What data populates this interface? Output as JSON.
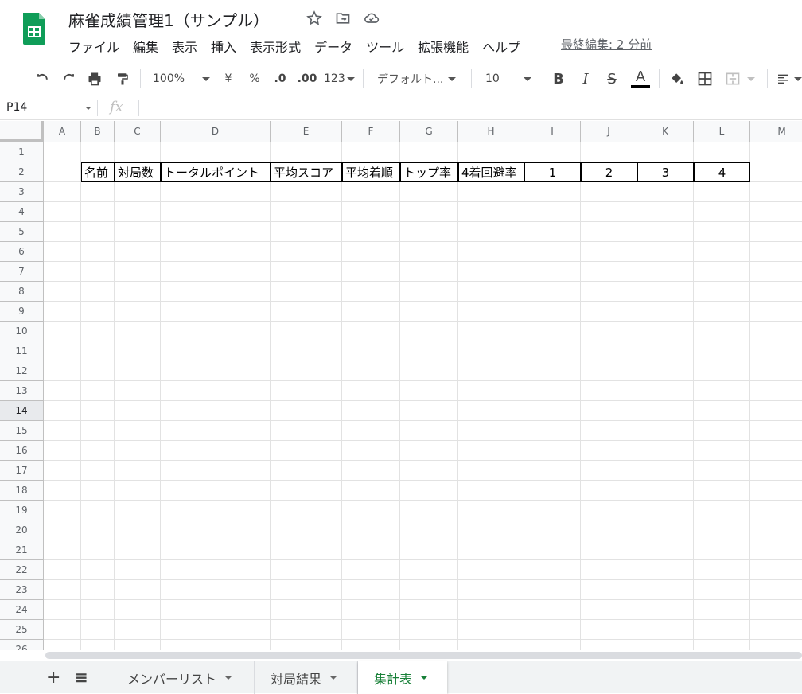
{
  "header": {
    "title": "麻雀成績管理1（サンプル）",
    "last_edit": "最終編集: 2 分前",
    "menu": [
      "ファイル",
      "編集",
      "表示",
      "挿入",
      "表示形式",
      "データ",
      "ツール",
      "拡張機能",
      "ヘルプ"
    ]
  },
  "toolbar": {
    "zoom": "100%",
    "currency": "¥",
    "percent": "%",
    "decimal_decrease": ".0",
    "decimal_increase": ".00",
    "number_format": "123",
    "font_family": "デフォルト...",
    "font_size": "10",
    "bold": "B",
    "italic": "I",
    "strike": "S",
    "text_color": "A"
  },
  "formula_bar": {
    "name_box": "P14",
    "fx": "fx"
  },
  "grid": {
    "columns": [
      "A",
      "B",
      "C",
      "D",
      "E",
      "F",
      "G",
      "H",
      "I",
      "J",
      "K",
      "L",
      "M"
    ],
    "rows": [
      "1",
      "2",
      "3",
      "4",
      "5",
      "6",
      "7",
      "8",
      "9",
      "10",
      "11",
      "12",
      "13",
      "14",
      "15",
      "16",
      "17",
      "18",
      "19",
      "20",
      "21",
      "22",
      "23",
      "24",
      "25",
      "26"
    ],
    "selected_row": "14",
    "row2": {
      "B": "名前",
      "C": "対局数",
      "D": "トータルポイント",
      "E": "平均スコア",
      "F": "平均着順",
      "G": "トップ率",
      "H": "4着回避率",
      "I": "1",
      "J": "2",
      "K": "3",
      "L": "4"
    }
  },
  "sheets": {
    "add": "+",
    "list": "≡",
    "tabs": [
      "メンバーリスト",
      "対局結果",
      "集計表"
    ],
    "active": "集計表"
  },
  "colors": {
    "accent_green": "#188038",
    "logo_green": "#0f9d58"
  }
}
